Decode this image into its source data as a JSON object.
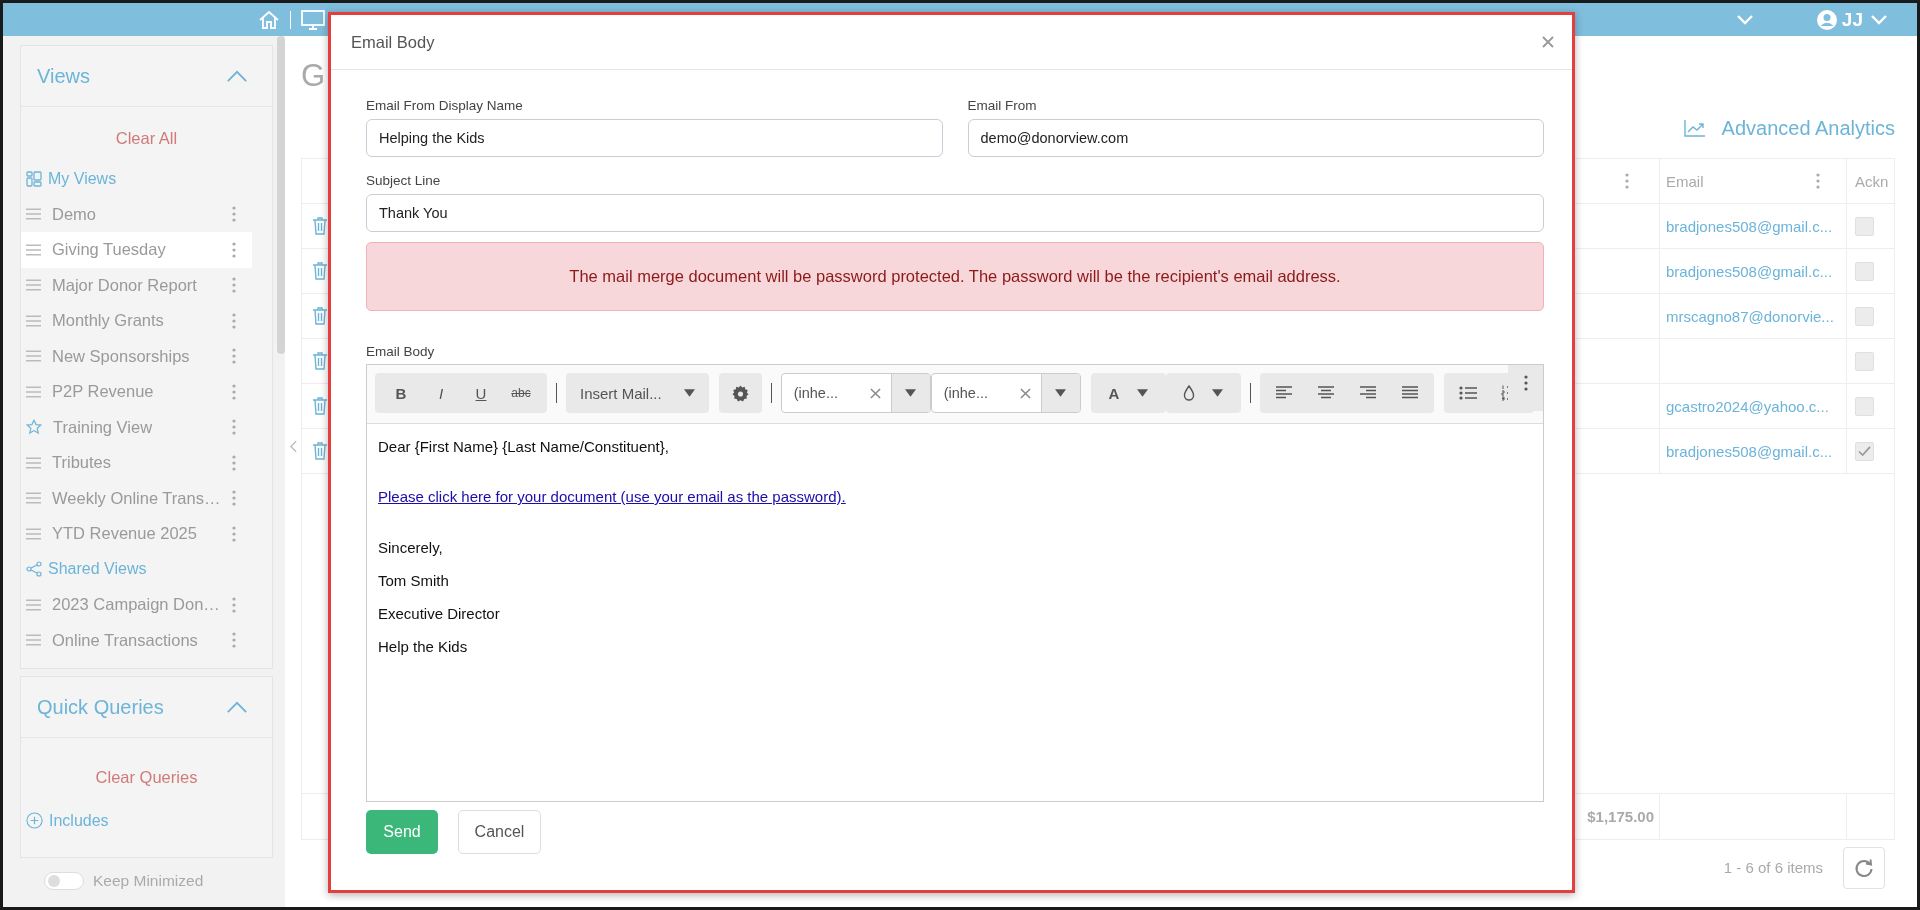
{
  "top_bar": {
    "user": "JJ"
  },
  "sidebar": {
    "views": {
      "title": "Views",
      "expanded": true,
      "clear": "Clear All",
      "my_views_label": "My Views",
      "my_views": [
        {
          "label": "Demo",
          "selected": false,
          "kind": "drag"
        },
        {
          "label": "Giving Tuesday",
          "selected": true,
          "kind": "drag"
        },
        {
          "label": "Major Donor Report",
          "selected": false,
          "kind": "drag"
        },
        {
          "label": "Monthly Grants",
          "selected": false,
          "kind": "drag"
        },
        {
          "label": "New Sponsorships",
          "selected": false,
          "kind": "drag"
        },
        {
          "label": "P2P Revenue",
          "selected": false,
          "kind": "drag"
        },
        {
          "label": "Training View",
          "selected": false,
          "kind": "star"
        },
        {
          "label": "Tributes",
          "selected": false,
          "kind": "drag"
        },
        {
          "label": "Weekly Online Trans…",
          "selected": false,
          "kind": "drag"
        },
        {
          "label": "YTD Revenue 2025",
          "selected": false,
          "kind": "drag"
        }
      ],
      "shared_label": "Shared Views",
      "shared_views": [
        {
          "label": "2023 Campaign Don…",
          "selected": false,
          "kind": "drag"
        },
        {
          "label": "Online Transactions",
          "selected": false,
          "kind": "drag"
        }
      ]
    },
    "quick_queries": {
      "title": "Quick Queries",
      "expanded": true,
      "clear": "Clear Queries",
      "includes": "Includes"
    },
    "keep_minimized": {
      "label": "Keep Minimized",
      "on": false
    }
  },
  "page": {
    "title": "G",
    "analytics_link": "Advanced Analytics",
    "table": {
      "columns": [
        {
          "label": "Email"
        },
        {
          "label": "Ackn"
        }
      ],
      "rows": [
        {
          "email": "bradjones508@gmail.c...",
          "acknowledged": false
        },
        {
          "email": "bradjones508@gmail.c...",
          "acknowledged": false
        },
        {
          "email": "mrscagno87@donorvie...",
          "acknowledged": false
        },
        {
          "acknowledged": false
        },
        {
          "email": "gcastro2024@yahoo.c...",
          "acknowledged": false
        },
        {
          "email": "bradjones508@gmail.c...",
          "acknowledged": true
        }
      ],
      "total": "$1,175.00",
      "pager": "1 - 6 of 6 items"
    }
  },
  "dialog": {
    "title": "Email Body",
    "fields": [
      {
        "label": "Email From Display Name",
        "value": "Helping the Kids"
      },
      {
        "label": "Email From",
        "value": "demo@donorview.com"
      },
      {
        "label": "Subject Line",
        "value": "Thank You"
      }
    ],
    "alert": "The mail merge document will be password protected. The password will be the recipient's email address.",
    "editor": {
      "label": "Email Body",
      "toolbar": {
        "format_buttons": [
          "B",
          "I",
          "U",
          "abc"
        ],
        "merge_field": "Insert Mail...",
        "font_family": "(inhe...",
        "font_size": "(inhe...",
        "font_color": "A"
      },
      "body": [
        {
          "kind": "text",
          "text": "Dear {First Name} {Last Name/Constituent},"
        },
        {
          "kind": "link",
          "text": "Please click here for your document (use your email as the password)."
        },
        {
          "kind": "text",
          "text": "Sincerely,"
        },
        {
          "kind": "text",
          "text": "Tom Smith"
        },
        {
          "kind": "text",
          "text": "Executive Director"
        },
        {
          "kind": "text",
          "text": "Help the Kids"
        }
      ]
    },
    "buttons": {
      "send": "Send",
      "cancel": "Cancel"
    }
  }
}
